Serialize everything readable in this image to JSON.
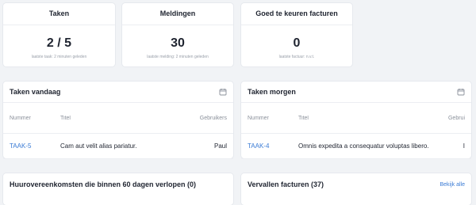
{
  "stats": [
    {
      "title": "Taken",
      "value": "2 / 5",
      "note": "laatste taak: 2 minuten geleden"
    },
    {
      "title": "Meldingen",
      "value": "30",
      "note": "laatste melding: 2 minuten geleden"
    },
    {
      "title": "Goed te keuren facturen",
      "value": "0",
      "note": "laatste factuur: n.v.t."
    }
  ],
  "today": {
    "title": "Taken vandaag",
    "columns": {
      "number": "Nummer",
      "title": "Titel",
      "users": "Gebruikers"
    },
    "rows": [
      {
        "number": "TAAK-5",
        "title": "Cam aut velit alias pariatur.",
        "user": "Paul"
      }
    ]
  },
  "tomorrow": {
    "title": "Taken morgen",
    "columns": {
      "number": "Nummer",
      "title": "Titel",
      "users": "Gebrui"
    },
    "rows": [
      {
        "number": "TAAK-4",
        "title": "Omnis expedita a consequatur voluptas libero.",
        "user": "I"
      }
    ]
  },
  "leases": {
    "title": "Huurovereenkomsten die binnen 60 dagen verlopen (0)"
  },
  "invoices": {
    "title": "Vervallen facturen (37)",
    "link": "Bekijk alle"
  },
  "colors": {
    "link": "#3a7bd5",
    "background": "#f1f3f6"
  },
  "icons": {
    "calendar": "calendar-icon"
  }
}
